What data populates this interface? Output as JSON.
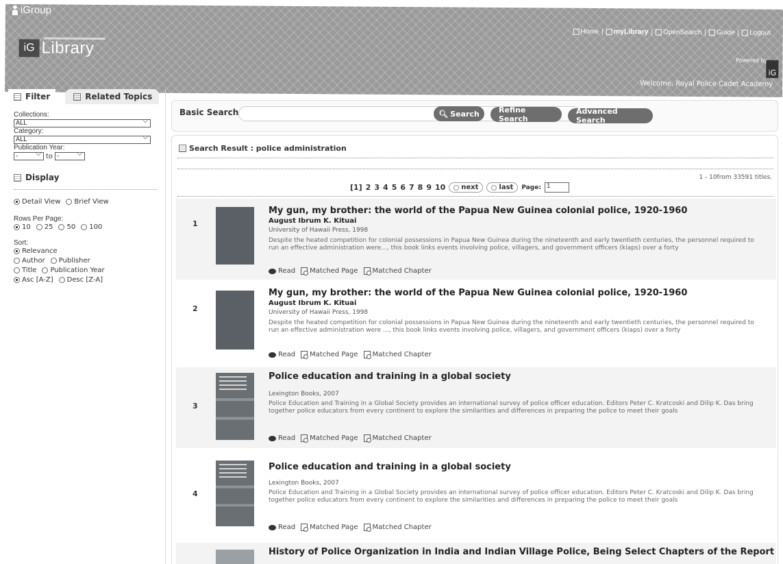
{
  "header": {
    "brand": "iGroup",
    "nav": [
      {
        "label": "Home",
        "icon": "home-icon"
      },
      {
        "label": "myLibrary",
        "icon": "library-icon"
      },
      {
        "label": "OpenSearch",
        "icon": "opensearch-icon"
      },
      {
        "label": "Guide",
        "icon": "guide-icon"
      },
      {
        "label": "Logout",
        "icon": "logout-icon"
      }
    ],
    "logo_ig": "iG",
    "logo_text": "Library",
    "powered_by": "Powered by",
    "powered_logo": "iG",
    "welcome": "Welcome, Royal Police Cadet Academy"
  },
  "sidebar": {
    "tabs": [
      {
        "label": "Filter",
        "active": true
      },
      {
        "label": "Related Topics",
        "active": false
      }
    ],
    "collections_label": "Collections:",
    "collections_value": "ALL",
    "category_label": "Category:",
    "category_value": "ALL",
    "year_label": "Publication Year:",
    "year_from": "-",
    "year_to_label": "to",
    "year_to": "-",
    "display_title": "Display",
    "view_options": [
      {
        "label": "Detail View",
        "selected": true
      },
      {
        "label": "Brief View",
        "selected": false
      }
    ],
    "rows_label": "Rows Per Page:",
    "rows_options": [
      {
        "label": "10",
        "selected": true
      },
      {
        "label": "25",
        "selected": false
      },
      {
        "label": "50",
        "selected": false
      },
      {
        "label": "100",
        "selected": false
      }
    ],
    "sort_label": "Sort:",
    "sort_options": [
      {
        "label": "Relevance",
        "selected": true
      },
      {
        "label": "Author",
        "selected": false
      },
      {
        "label": "Publisher",
        "selected": false
      },
      {
        "label": "Title",
        "selected": false
      },
      {
        "label": "Publication Year",
        "selected": false
      }
    ],
    "order_options": [
      {
        "label": "Asc [A-Z]",
        "selected": true
      },
      {
        "label": "Desc [Z-A]",
        "selected": false
      }
    ]
  },
  "search": {
    "label": "Basic Search:",
    "value": "",
    "search_btn": "Search",
    "refine_btn": "Refine Search",
    "advanced_btn": "Advanced Search"
  },
  "results": {
    "heading": "Search Result : police administration",
    "count": "1 - 10from 33591 titles.",
    "pages": [
      "[1]",
      "2",
      "3",
      "4",
      "5",
      "6",
      "7",
      "8",
      "9",
      "10"
    ],
    "next": "next",
    "last": "last",
    "page_label": "Page:",
    "page_value": "1",
    "read_label": "Read",
    "matched_page_label": "Matched Page",
    "matched_chapter_label": "Matched Chapter",
    "items": [
      {
        "num": "1",
        "title": "My gun, my brother: the world of the Papua New Guinea colonial police, 1920-1960",
        "author": "August Ibrum K. Kituai",
        "publisher": "University of Hawaii Press, 1998",
        "description": "Despite the heated competition for colonial possessions in Papua New Guinea during the nineteenth and early twentieth centuries, the personnel required to run an effective administration were..., this book links events involving police, villagers, and government officers (kiaps) over a forty"
      },
      {
        "num": "2",
        "title": "My gun, my brother: the world of the Papua New Guinea colonial police, 1920-1960",
        "author": "August Ibrum K. Kituai",
        "publisher": "University of Hawaii Press, 1998",
        "description": "Despite the heated competition for colonial possessions in Papua New Guinea during the nineteenth and early twentieth centuries, the personnel required to run an effective administration were ..., this book links events involving police, villagers, and government officers (kiaps) over a forty"
      },
      {
        "num": "3",
        "title": "Police education and training in a global society",
        "author": "",
        "publisher": "Lexington Books, 2007",
        "description": "Police Education and Training in a Global Society provides an international survey of police officer education. Editors Peter C. Kratcoski and Dilip K. Das bring together police educators from every continent to explore the similarities and differences in preparing the police to meet their goals"
      },
      {
        "num": "4",
        "title": "Police education and training in a global society",
        "author": "",
        "publisher": "Lexington Books, 2007",
        "description": "Police Education and Training in a Global Society provides an international survey of police officer education. Editors Peter C. Kratcoski and Dilip K. Das bring together police educators from every continent to explore the similarities and differences in preparing the police to meet their goals"
      },
      {
        "num": "",
        "title": "History of Police Organization in India and Indian Village Police, Being Select Chapters of the Report",
        "author": "",
        "publisher": "",
        "description": ""
      }
    ]
  }
}
